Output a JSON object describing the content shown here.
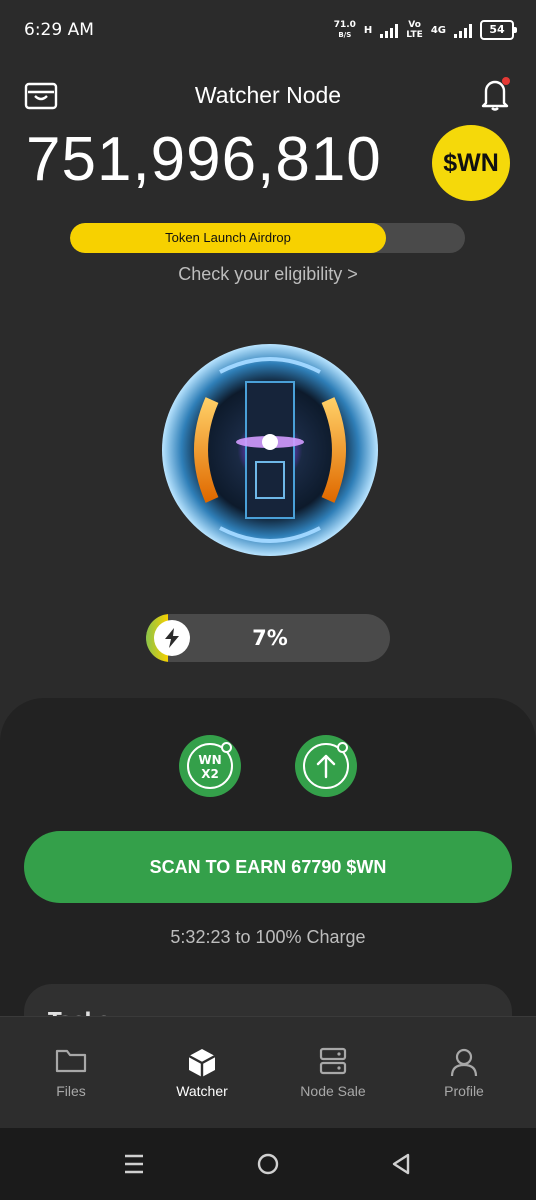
{
  "status_bar": {
    "time": "6:29 AM",
    "net_speed_value": "71.0",
    "net_speed_unit": "B/S",
    "network_h": "H",
    "volte_top": "Vo",
    "volte_bottom": "LTE",
    "network_4g": "4G",
    "battery": "54"
  },
  "header": {
    "title": "Watcher Node",
    "left_icon": "wallet-icon",
    "right_icon": "bell-icon",
    "notification_dot_color": "#e53935"
  },
  "balance": {
    "amount": "751,996,810",
    "token_badge": "$WN"
  },
  "airdrop": {
    "label": "Token Launch Airdrop",
    "progress": 0.8,
    "link": "Check your eligibility >"
  },
  "charge": {
    "percent_label": "7%",
    "level": 0.07
  },
  "boosts": {
    "x2_top": "WN",
    "x2_bottom": "X2",
    "upgrade_icon": "arrow-up-icon"
  },
  "scan_button": "SCAN TO EARN 67790 $WN",
  "charge_timer": "5:32:23 to 100% Charge",
  "tasks_card": {
    "title": "Tasks"
  },
  "tabs": [
    {
      "label": "Files",
      "icon": "folder-icon"
    },
    {
      "label": "Watcher",
      "icon": "cube-icon",
      "active": true
    },
    {
      "label": "Node Sale",
      "icon": "server-icon"
    },
    {
      "label": "Profile",
      "icon": "user-icon"
    }
  ],
  "colors": {
    "background": "#2b2b2b",
    "accent_yellow": "#f7d100",
    "accent_green": "#34a04a"
  }
}
